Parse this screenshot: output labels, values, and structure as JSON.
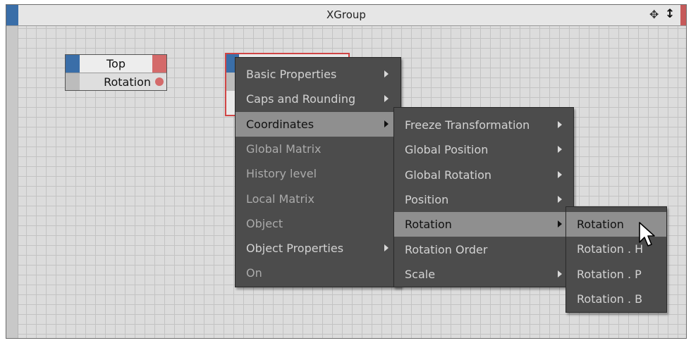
{
  "window": {
    "title": "XGroup"
  },
  "icons": {
    "move": "move-icon",
    "resize": "up-down-arrows-icon",
    "cursor": "mouse-pointer-icon"
  },
  "node_top": {
    "title": "Top",
    "port_label": "Rotation"
  },
  "menu_main": {
    "items": [
      {
        "label": "Basic Properties",
        "submenu": true
      },
      {
        "label": "Caps and Rounding",
        "submenu": true
      },
      {
        "label": "Coordinates",
        "submenu": true,
        "selected": true
      },
      {
        "label": "Global Matrix",
        "submenu": false
      },
      {
        "label": "History level",
        "submenu": false
      },
      {
        "label": "Local Matrix",
        "submenu": false
      },
      {
        "label": "Object",
        "submenu": false
      },
      {
        "label": "Object Properties",
        "submenu": true
      },
      {
        "label": "On",
        "submenu": false
      }
    ]
  },
  "menu_coordinates": {
    "items": [
      {
        "label": "Freeze Transformation",
        "submenu": true
      },
      {
        "label": "Global Position",
        "submenu": true
      },
      {
        "label": "Global Rotation",
        "submenu": true
      },
      {
        "label": "Position",
        "submenu": true
      },
      {
        "label": "Rotation",
        "submenu": true,
        "selected": true
      },
      {
        "label": "Rotation Order",
        "submenu": false
      },
      {
        "label": "Scale",
        "submenu": true
      }
    ]
  },
  "menu_rotation": {
    "items": [
      {
        "label": "Rotation",
        "selected": true
      },
      {
        "label": "Rotation . H"
      },
      {
        "label": "Rotation . P"
      },
      {
        "label": "Rotation . B"
      }
    ]
  },
  "colors": {
    "accent_blue": "#3a6ea8",
    "accent_red": "#d46a6a",
    "menu_bg": "#4c4c4c",
    "menu_selected": "#8f8f8f"
  }
}
